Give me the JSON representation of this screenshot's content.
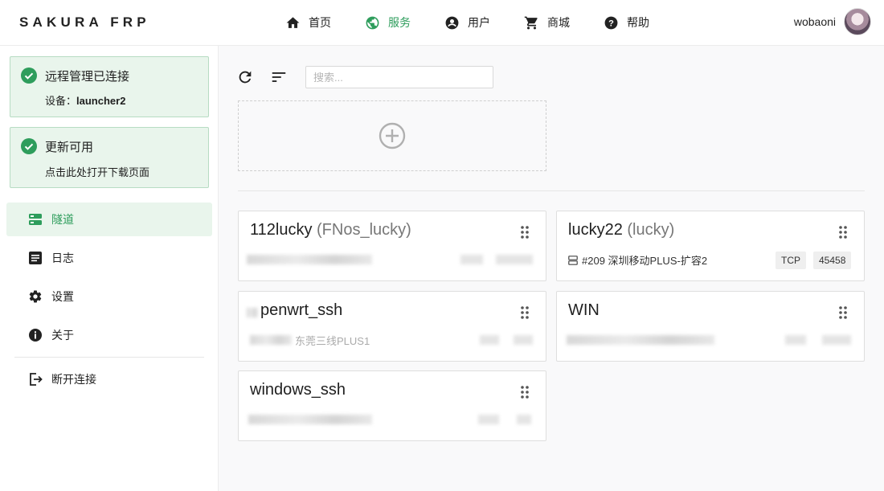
{
  "header": {
    "brand": "SAKURA FRP",
    "nav": [
      {
        "label": "首页",
        "icon": "home-icon"
      },
      {
        "label": "服务",
        "icon": "globe-icon",
        "active": true
      },
      {
        "label": "用户",
        "icon": "account-icon"
      },
      {
        "label": "商城",
        "icon": "cart-icon"
      },
      {
        "label": "帮助",
        "icon": "help-icon"
      }
    ],
    "username": "wobaoni"
  },
  "sidebar": {
    "notices": [
      {
        "title": "远程管理已连接",
        "detail_label": "设备：",
        "detail_value": "launcher2"
      },
      {
        "title": "更新可用",
        "detail": "点击此处打开下载页面"
      }
    ],
    "menu": [
      {
        "label": "隧道",
        "icon": "tunnel-icon",
        "active": true
      },
      {
        "label": "日志",
        "icon": "log-icon"
      },
      {
        "label": "设置",
        "icon": "gear-icon"
      },
      {
        "label": "关于",
        "icon": "info-icon"
      }
    ],
    "disconnect": {
      "label": "断开连接",
      "icon": "logout-icon"
    }
  },
  "main": {
    "search": {
      "placeholder": "搜索...",
      "value": ""
    },
    "tunnels": [
      {
        "name": "112lucky",
        "alias": "(FNos_lucky)",
        "node": "",
        "type": "",
        "port": "",
        "obscured": true
      },
      {
        "name": "lucky22",
        "alias": "(lucky)",
        "node": "#209 深圳移动PLUS-扩容2",
        "type": "TCP",
        "port": "45458",
        "obscured": false
      },
      {
        "name": "penwrt_ssh",
        "alias": "",
        "node": "东莞三线PLUS1",
        "type": "",
        "port": "",
        "obscured": true
      },
      {
        "name": "WIN",
        "alias": "",
        "node": "",
        "type": "",
        "port": "",
        "obscured": true
      },
      {
        "name": "windows_ssh",
        "alias": "",
        "node": "",
        "type": "",
        "port": "",
        "obscured": true
      }
    ]
  },
  "colors": {
    "accent": "#2e9d5c",
    "notice_bg": "#e9f5ec",
    "notice_border": "#b7dcc3"
  }
}
